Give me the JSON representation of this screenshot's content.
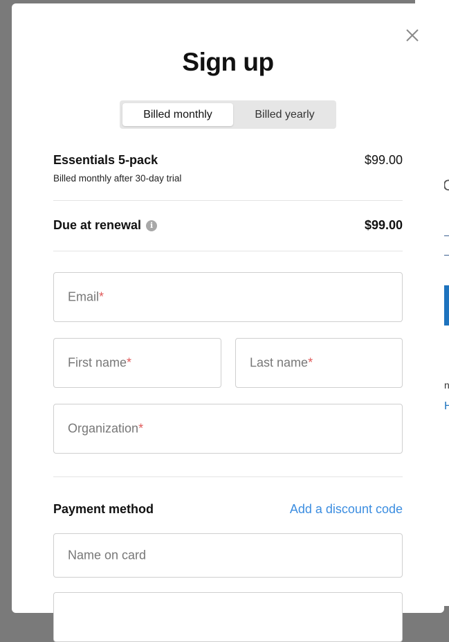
{
  "modal": {
    "title": "Sign up",
    "close_icon": "close-icon"
  },
  "billing_toggle": {
    "options": [
      {
        "label": "Billed monthly",
        "selected": true
      },
      {
        "label": "Billed yearly",
        "selected": false
      }
    ]
  },
  "plan": {
    "name": "Essentials 5-pack",
    "subtitle": "Billed monthly after 30-day trial",
    "price": "$99.00"
  },
  "renewal": {
    "label": "Due at renewal",
    "info_icon": "info-icon",
    "info_glyph": "i",
    "price": "$99.00"
  },
  "form": {
    "required_mark": "*",
    "email_placeholder": "Email",
    "first_name_placeholder": "First name",
    "last_name_placeholder": "Last name",
    "organization_placeholder": "Organization"
  },
  "payment": {
    "label": "Payment method",
    "discount_link": "Add a discount code",
    "name_on_card_placeholder": "Name on card"
  },
  "colors": {
    "accent_link": "#3b8de0",
    "required": "#e05a5a",
    "toggle_bg": "#e6e6e6",
    "overlay": "#7a7a7a"
  }
}
